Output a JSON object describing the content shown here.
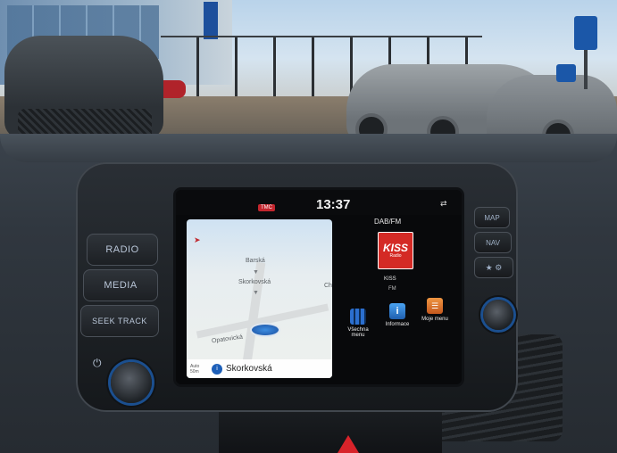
{
  "screen": {
    "tmc_badge": "TMC",
    "clock": "13:37"
  },
  "map": {
    "labels": [
      "Barská",
      "Skorkovská",
      "Ch",
      "Opatovická"
    ],
    "auto_zoom": "Auto 50m",
    "street_icon": "i",
    "street_name": "Skorkovská"
  },
  "radio": {
    "band": "DAB/FM",
    "logo_title": "KISS",
    "logo_subtitle": "Radio",
    "station": "KISS",
    "station_band": "FM"
  },
  "apps": [
    {
      "label": "Všechna menu",
      "icon": "grid-icon"
    },
    {
      "label": "Informace",
      "icon": "info-icon"
    },
    {
      "label": "Moje menu",
      "icon": "my-menu-icon"
    }
  ],
  "left_buttons": {
    "radio": "RADIO",
    "media": "MEDIA",
    "seek": "SEEK TRACK"
  },
  "right_buttons": {
    "map": "MAP",
    "nav": "NAV",
    "fav": "★ ⚙"
  },
  "colors": {
    "accent_blue": "#1b4f8f",
    "logo_red": "#d42a25"
  }
}
